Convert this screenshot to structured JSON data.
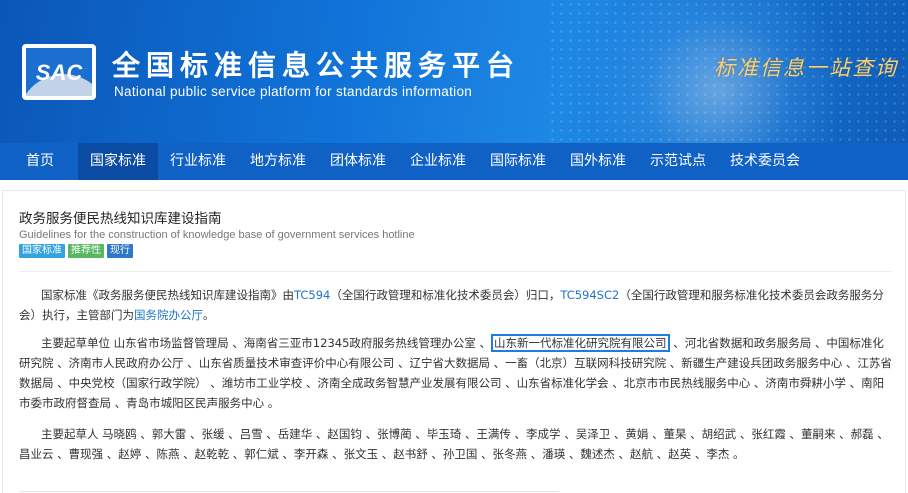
{
  "header": {
    "logo_text": "SAC",
    "title": "全国标准信息公共服务平台",
    "subtitle": "National public service platform  for standards information",
    "slogan": "标准信息一站查询"
  },
  "nav": {
    "items": [
      {
        "label": "首页",
        "active": false
      },
      {
        "label": "国家标准",
        "active": true
      },
      {
        "label": "行业标准",
        "active": false
      },
      {
        "label": "地方标准",
        "active": false
      },
      {
        "label": "团体标准",
        "active": false
      },
      {
        "label": "企业标准",
        "active": false
      },
      {
        "label": "国际标准",
        "active": false
      },
      {
        "label": "国外标准",
        "active": false
      },
      {
        "label": "示范试点",
        "active": false
      },
      {
        "label": "技术委员会",
        "active": false
      }
    ]
  },
  "standard": {
    "title": "政务服务便民热线知识库建设指南",
    "title_en": "Guidelines for the construction of knowledge base of government services hotline",
    "tags": [
      "国家标准",
      "推荐性",
      "现行"
    ]
  },
  "paragraph1": {
    "part1": "国家标准《政务服务便民热线知识库建设指南》由",
    "tc_link": "TC594",
    "part2": "（全国行政管理和标准化技术委员会）归口，",
    "sc_link": "TC594SC2",
    "part3": "（全国行政管理和服务标准化技术委员会政务服务分会）执行，主管部门为",
    "dept_link": "国务院办公厅",
    "part4": "。"
  },
  "paragraph2": {
    "before": "主要起草单位 山东省市场监督管理局 、海南省三亚市12345政府服务热线管理办公室 、",
    "highlighted": "山东新一代标准化研究院有限公司",
    "after": " 、河北省数据和政务服务局 、中国标准化研究院 、济南市人民政府办公厅 、山东省质量技术审查评价中心有限公司 、辽宁省大数据局 、一畜（北京）互联网科技研究院 、新疆生产建设兵团政务服务中心 、江苏省数据局 、中央党校（国家行政学院） 、潍坊市工业学校 、济南全成政务智慧产业发展有限公司 、山东省标准化学会 、北京市市民热线服务中心 、济南市舜耕小学 、南阳市委市政府督查局 、青岛市城阳区民声服务中心 。"
  },
  "paragraph3": {
    "text": "主要起草人 马晓鸥 、郭大雷 、张缓 、吕雪 、岳建华 、赵国钧 、张博蔺 、毕玉琦 、王满传 、李成学 、吴泽卫 、黄娟 、董杲 、胡绍武 、张红霞 、董嗣来 、郝磊 、昌业云 、曹现强 、赵婷 、陈燕 、赵乾乾 、郭仁斌 、李开森 、张文玉 、赵书舒 、孙卫国 、张冬燕 、潘瑛 、魏述杰 、赵航 、赵英 、李杰 。"
  },
  "colors": {
    "banner": "#1173d8",
    "nav": "#1061c5",
    "nav_active": "#0a4ba3",
    "link": "#1d74c9",
    "highlight_border": "#1a7fe0"
  }
}
